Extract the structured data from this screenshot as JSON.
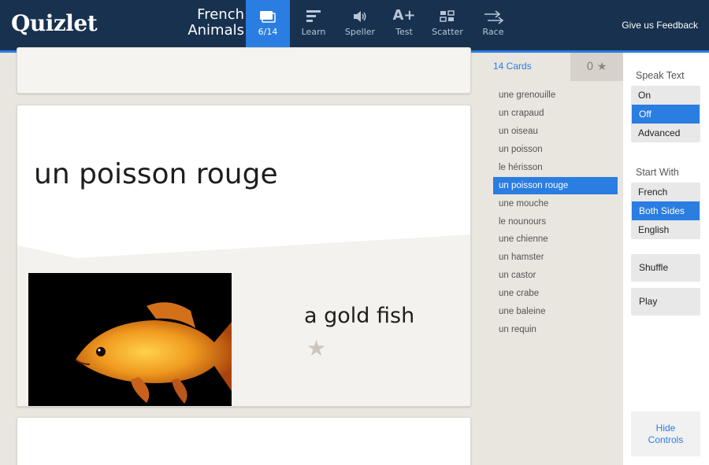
{
  "header": {
    "logo": "Quizlet",
    "set_title_line1": "French",
    "set_title_line2": "Animals",
    "modes": [
      {
        "label": "6/14",
        "icon": "flashcards-icon",
        "active": true
      },
      {
        "label": "Learn",
        "icon": "learn-icon"
      },
      {
        "label": "Speller",
        "icon": "speaker-icon"
      },
      {
        "label": "Test",
        "icon": "test-icon"
      },
      {
        "label": "Scatter",
        "icon": "scatter-icon"
      },
      {
        "label": "Race",
        "icon": "race-icon"
      }
    ],
    "feedback": "Give us Feedback"
  },
  "card": {
    "term": "un poisson rouge",
    "definition": "a gold fish",
    "star": "★"
  },
  "card_list": {
    "count_label": "14 Cards",
    "star_count": "0 ★",
    "items": [
      "une grenouille",
      "un crapaud",
      "un oiseau",
      "un poisson",
      "le hérisson",
      "un poisson rouge",
      "une mouche",
      "le nounours",
      "une chienne",
      "un hamster",
      "un castor",
      "une crabe",
      "une baleine",
      "un requin"
    ],
    "selected_index": 5
  },
  "controls": {
    "speak_text_label": "Speak Text",
    "speak_text_options": [
      "On",
      "Off",
      "Advanced"
    ],
    "speak_text_selected": "Off",
    "start_with_label": "Start With",
    "start_with_options": [
      "French",
      "Both Sides",
      "English"
    ],
    "start_with_selected": "Both Sides",
    "shuffle": "Shuffle",
    "play": "Play",
    "hide_line1": "Hide",
    "hide_line2": "Controls"
  },
  "colors": {
    "header_bg": "#17314f",
    "accent": "#2a7de1"
  }
}
